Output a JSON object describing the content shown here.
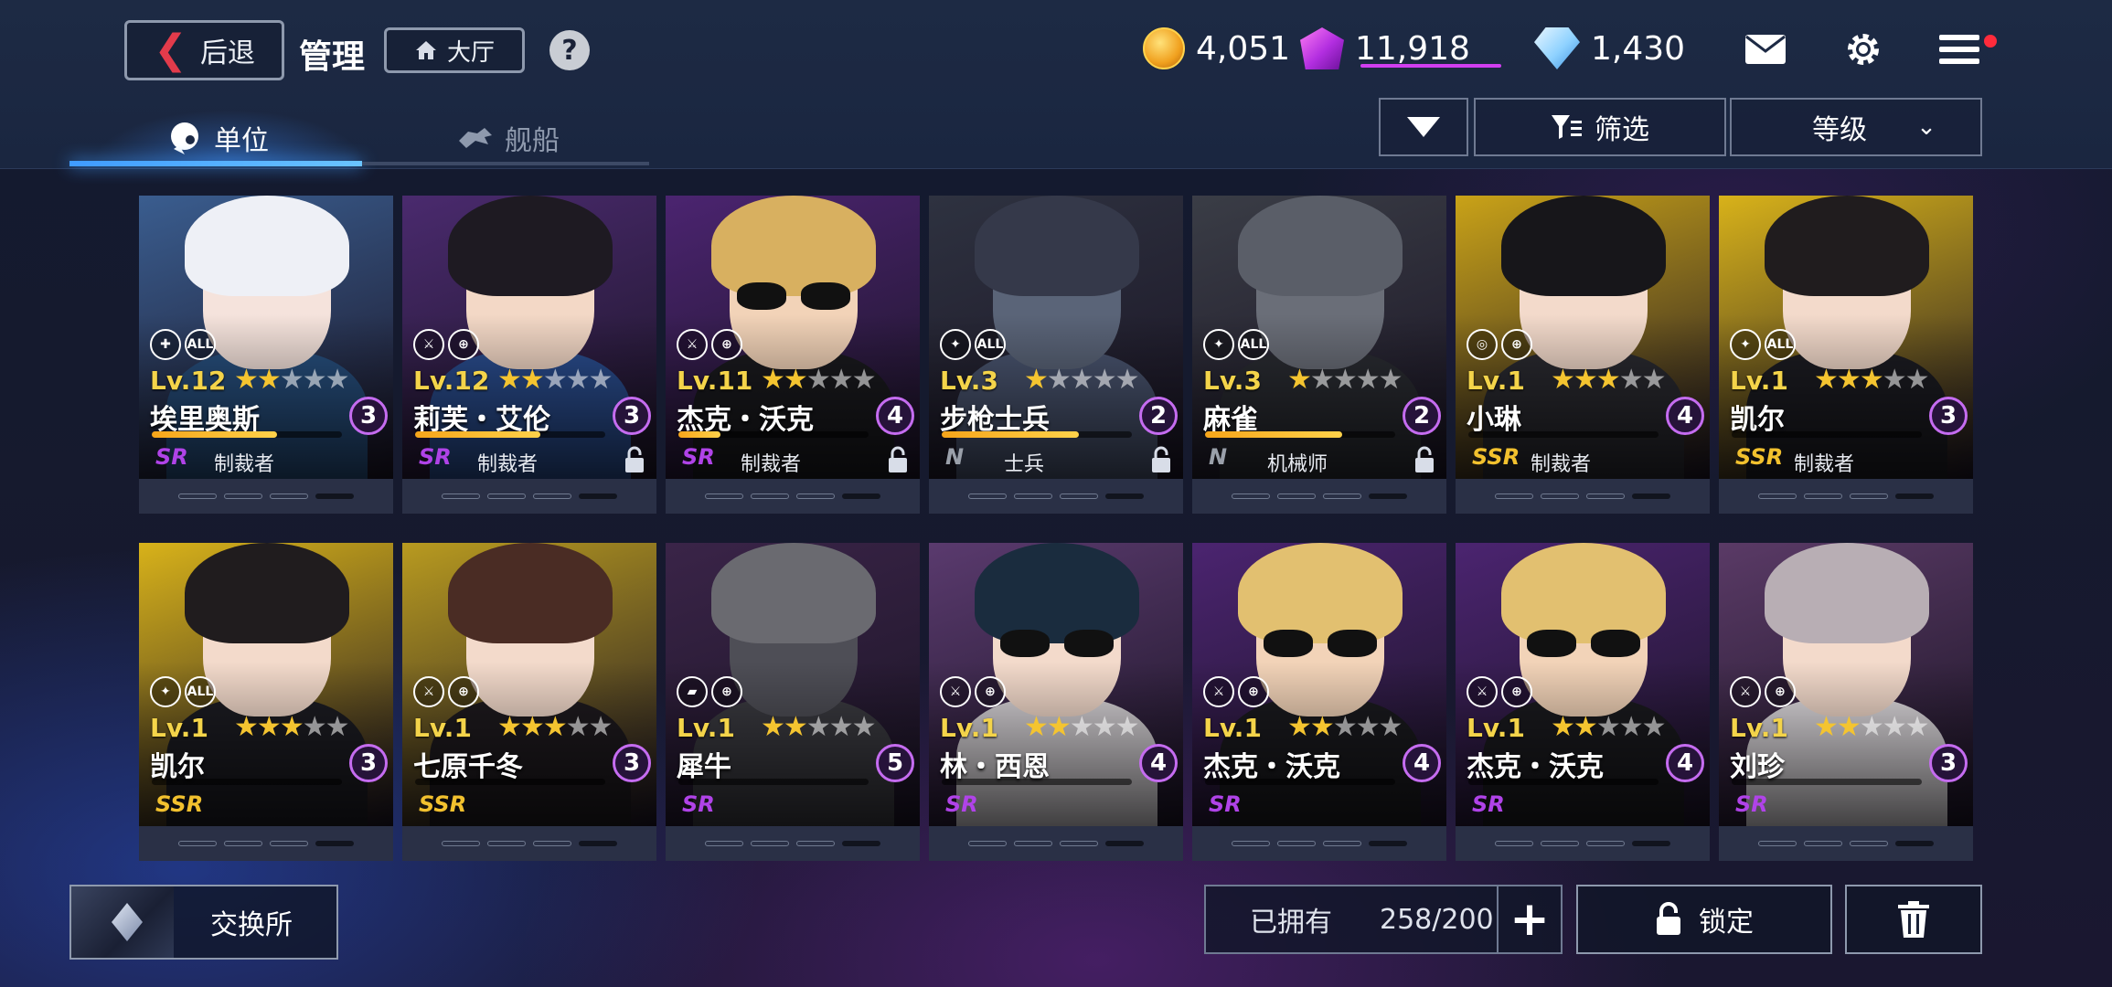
{
  "header": {
    "back_label": "后退",
    "title": "管理",
    "lobby_label": "大厅",
    "help_label": "?"
  },
  "currencies": [
    {
      "icon": "gold-coin-icon",
      "value": "4,051"
    },
    {
      "icon": "purple-gem-icon",
      "value": "11,918"
    },
    {
      "icon": "blue-diamond-icon",
      "value": "1,430"
    }
  ],
  "tabs": [
    {
      "label": "单位",
      "active": true,
      "icon": "unit-icon"
    },
    {
      "label": "舰船",
      "active": false,
      "icon": "ship-icon"
    }
  ],
  "controls": {
    "filter_label": "筛选",
    "sort_label": "等级"
  },
  "units": [
    {
      "level": "Lv.12",
      "stars": 2,
      "name": "埃里奥斯",
      "cost": "3",
      "rarity": "SR",
      "class": "制裁者",
      "types": [
        "support-icon",
        "all-target-icon"
      ],
      "type_text": [
        "✚",
        "ALL"
      ],
      "hp": 0.66,
      "locked": false,
      "palette": {
        "bg": "#3a5d8f",
        "hair": "#eef0f6",
        "body": "#274f7e",
        "skin": "#f5e3dc"
      },
      "glasses": false
    },
    {
      "level": "Lv.12",
      "stars": 2,
      "name": "莉芙・艾伦",
      "cost": "3",
      "rarity": "SR",
      "class": "制裁者",
      "types": [
        "sword-icon",
        "ground-target-icon"
      ],
      "type_text": [
        "⚔",
        "⊕"
      ],
      "hp": 0.66,
      "locked": true,
      "palette": {
        "bg": "#4a2a6e",
        "hair": "#1e1a22",
        "body": "#2a4d8f",
        "skin": "#f3d8c6"
      },
      "glasses": false
    },
    {
      "level": "Lv.11",
      "stars": 2,
      "name": "杰克・沃克",
      "cost": "4",
      "rarity": "SR",
      "class": "制裁者",
      "types": [
        "sword-icon",
        "ground-target-icon"
      ],
      "type_text": [
        "⚔",
        "⊕"
      ],
      "hp": 0.22,
      "locked": true,
      "palette": {
        "bg": "#4b2470",
        "hair": "#d8b060",
        "body": "#1a1a1e",
        "skin": "#f2d3b8"
      },
      "glasses": true
    },
    {
      "level": "Lv.3",
      "stars": 1,
      "name": "步枪士兵",
      "cost": "2",
      "rarity": "N",
      "class": "士兵",
      "types": [
        "rifle-icon",
        "all-target-icon"
      ],
      "type_text": [
        "✦",
        "ALL"
      ],
      "hp": 0.72,
      "locked": true,
      "palette": {
        "bg": "#2e3240",
        "hair": "#35394a",
        "body": "#4a5570",
        "skin": "#5a6478"
      },
      "glasses": false
    },
    {
      "level": "Lv.3",
      "stars": 1,
      "name": "麻雀",
      "cost": "2",
      "rarity": "N",
      "class": "机械师",
      "types": [
        "rifle-icon",
        "all-target-icon"
      ],
      "type_text": [
        "✦",
        "ALL"
      ],
      "hp": 0.72,
      "locked": true,
      "palette": {
        "bg": "#3a3d46",
        "hair": "#5a5e68",
        "body": "#2a2c32",
        "skin": "#6a6e78"
      },
      "glasses": false
    },
    {
      "level": "Lv.1",
      "stars": 3,
      "name": "小琳",
      "cost": "4",
      "rarity": "SSR",
      "class": "制裁者",
      "types": [
        "crosshair-icon",
        "ground-target-icon"
      ],
      "type_text": [
        "◎",
        "⊕"
      ],
      "hp": 0.0,
      "locked": false,
      "palette": {
        "bg": "#c9a218",
        "hair": "#17161a",
        "body": "#2a2a30",
        "skin": "#f3dacb"
      },
      "glasses": false
    },
    {
      "level": "Lv.1",
      "stars": 3,
      "name": "凯尔",
      "cost": "3",
      "rarity": "SSR",
      "class": "制裁者",
      "types": [
        "rifle-icon",
        "all-target-icon"
      ],
      "type_text": [
        "✦",
        "ALL"
      ],
      "hp": 0.0,
      "locked": false,
      "palette": {
        "bg": "#d8b21a",
        "hair": "#201c1e",
        "body": "#1c1c22",
        "skin": "#f3dacb"
      },
      "glasses": false
    },
    {
      "level": "Lv.1",
      "stars": 3,
      "name": "凯尔",
      "cost": "3",
      "rarity": "SSR",
      "class": "",
      "types": [
        "rifle-icon",
        "all-target-icon"
      ],
      "type_text": [
        "✦",
        "ALL"
      ],
      "hp": 0.0,
      "locked": false,
      "palette": {
        "bg": "#d8b21a",
        "hair": "#201c1e",
        "body": "#1c1c22",
        "skin": "#f3dacb"
      },
      "glasses": false
    },
    {
      "level": "Lv.1",
      "stars": 3,
      "name": "七原千冬",
      "cost": "3",
      "rarity": "SSR",
      "class": "",
      "types": [
        "sword-icon",
        "ground-target-icon"
      ],
      "type_text": [
        "⚔",
        "⊕"
      ],
      "hp": 0.0,
      "locked": false,
      "palette": {
        "bg": "#b89a20",
        "hair": "#4a2c24",
        "body": "#1e1a1e",
        "skin": "#f3dacb"
      },
      "glasses": false
    },
    {
      "level": "Lv.1",
      "stars": 2,
      "name": "犀牛",
      "cost": "5",
      "rarity": "SR",
      "class": "",
      "types": [
        "tank-icon",
        "ground-target-icon"
      ],
      "type_text": [
        "▰",
        "⊕"
      ],
      "hp": 0.0,
      "locked": false,
      "palette": {
        "bg": "#3a2448",
        "hair": "#6a6a70",
        "body": "#3a3a40",
        "skin": "#4e4e56"
      },
      "glasses": false
    },
    {
      "level": "Lv.1",
      "stars": 2,
      "name": "林・西恩",
      "cost": "4",
      "rarity": "SR",
      "class": "",
      "types": [
        "sword-icon",
        "ground-target-icon"
      ],
      "type_text": [
        "⚔",
        "⊕"
      ],
      "hp": 0.0,
      "locked": false,
      "palette": {
        "bg": "#5a3a6e",
        "hair": "#1a2c3e",
        "body": "#d8d4d8",
        "skin": "#f3dacb"
      },
      "glasses": true
    },
    {
      "level": "Lv.1",
      "stars": 2,
      "name": "杰克・沃克",
      "cost": "4",
      "rarity": "SR",
      "class": "",
      "types": [
        "sword-icon",
        "ground-target-icon"
      ],
      "type_text": [
        "⚔",
        "⊕"
      ],
      "hp": 0.0,
      "locked": false,
      "palette": {
        "bg": "#4b2470",
        "hair": "#e2c070",
        "body": "#1a1a1e",
        "skin": "#f2d3b8"
      },
      "glasses": true
    },
    {
      "level": "Lv.1",
      "stars": 2,
      "name": "杰克・沃克",
      "cost": "4",
      "rarity": "SR",
      "class": "",
      "types": [
        "sword-icon",
        "ground-target-icon"
      ],
      "type_text": [
        "⚔",
        "⊕"
      ],
      "hp": 0.0,
      "locked": false,
      "palette": {
        "bg": "#4b2470",
        "hair": "#e2c070",
        "body": "#1a1a1e",
        "skin": "#f2d3b8"
      },
      "glasses": true
    },
    {
      "level": "Lv.1",
      "stars": 2,
      "name": "刘珍",
      "cost": "3",
      "rarity": "SR",
      "class": "",
      "types": [
        "sword-icon",
        "ground-target-icon"
      ],
      "type_text": [
        "⚔",
        "⊕"
      ],
      "hp": 0.0,
      "locked": false,
      "palette": {
        "bg": "#5a3a66",
        "hair": "#b8aeb4",
        "body": "#e0dce0",
        "skin": "#f3dacb"
      },
      "glasses": false
    }
  ],
  "footer": {
    "exchange_label": "交换所",
    "owned_label": "已拥有",
    "owned_count": "258/200",
    "lock_label": "锁定"
  },
  "colors": {
    "accent_blue": "#3f9bff",
    "cost_ring": "#c56cf0",
    "level_gold": "#f4d44a",
    "notification_red": "#ff2b3b"
  }
}
